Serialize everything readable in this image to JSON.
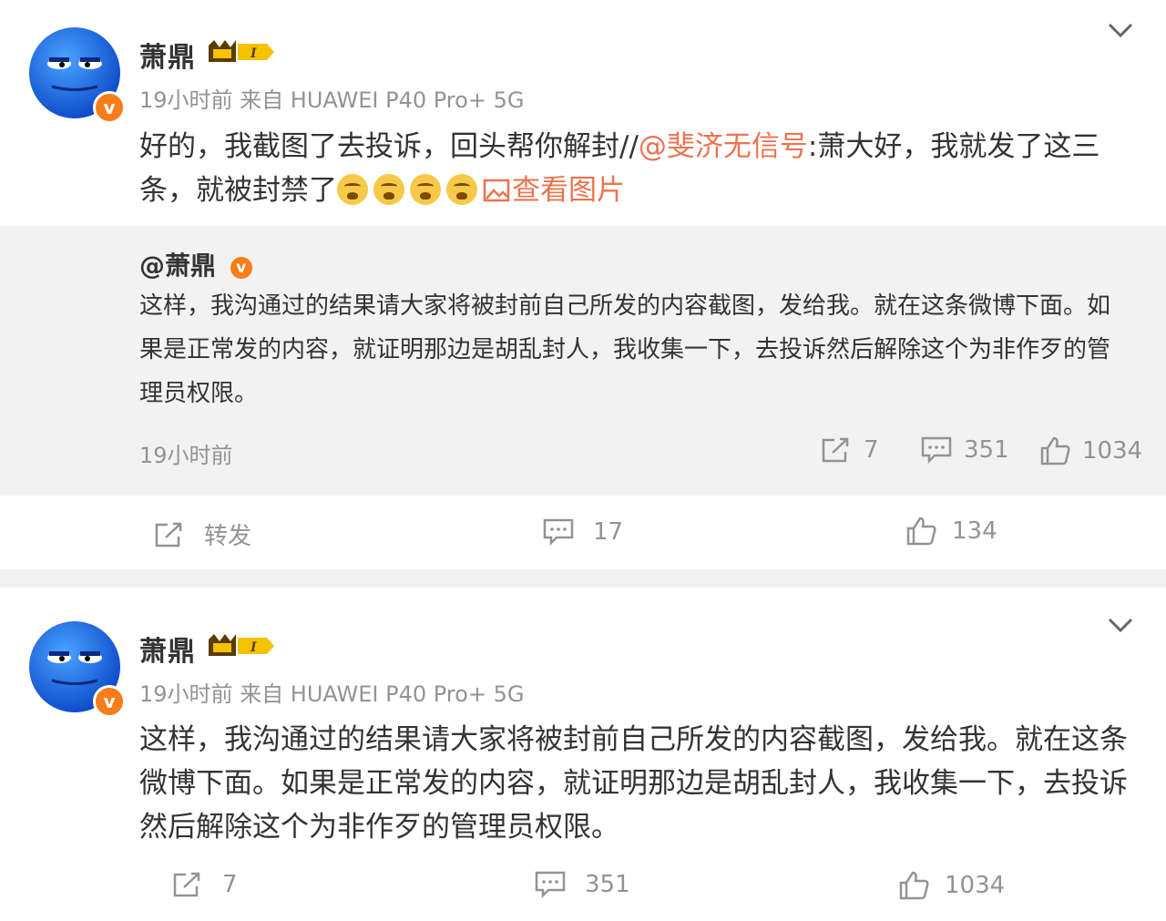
{
  "post1": {
    "username": "萧鼎",
    "meta": "19小时前 来自 HUAWEI P40 Pro+ 5G",
    "text_a": "好的，我截图了去投诉，回头帮你解封//",
    "mention": "@斐济无信号",
    "text_b": ":萧大好，我就发了这三",
    "text_c": "条，就被封禁了",
    "view_image": "查看图片",
    "quote": {
      "author": "@萧鼎",
      "text": "这样，我沟通过的结果请大家将被封前自己所发的内容截图，发给我。就在这条微博下面。如果是正常发的内容，就证明那边是胡乱封人，我收集一下，去投诉然后解除这个为非作歹的管理员权限。",
      "time": "19小时前",
      "reposts": "7",
      "comments": "351",
      "likes": "1034"
    },
    "actions": {
      "repost_label": "转发",
      "comments": "17",
      "likes": "134"
    }
  },
  "post2": {
    "username": "萧鼎",
    "meta": "19小时前 来自 HUAWEI P40 Pro+ 5G",
    "text": "这样，我沟通过的结果请大家将被封前自己所发的内容截图，发给我。就在这条微博下面。如果是正常发的内容，就证明那边是胡乱封人，我收集一下，去投诉然后解除这个为非作歹的管理员权限。",
    "reposts": "7",
    "comments": "351",
    "likes": "1034"
  },
  "colors": {
    "accent": "#eb7350",
    "meta": "#939393",
    "verified": "#f77d1a",
    "quote_bg": "#f2f2f2"
  },
  "icons": [
    "chevron-down-icon",
    "crown-badge-icon",
    "verified-icon",
    "repost-icon",
    "comment-icon",
    "like-icon",
    "image-icon",
    "crying-emoji-icon"
  ]
}
